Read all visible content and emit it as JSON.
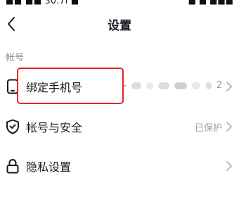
{
  "status_bar": {
    "left": "■■ ■■ 30.7ı ■",
    "right": "■ ■ ■■■"
  },
  "header": {
    "title": "设置"
  },
  "section": {
    "label": "帐号"
  },
  "rows": [
    {
      "label": "绑定手机号",
      "value": "2",
      "icon": "phone-icon"
    },
    {
      "label": "帐号与安全",
      "value": "已保护",
      "icon": "shield-check-icon"
    },
    {
      "label": "隐私设置",
      "value": "",
      "icon": "lock-icon"
    }
  ]
}
